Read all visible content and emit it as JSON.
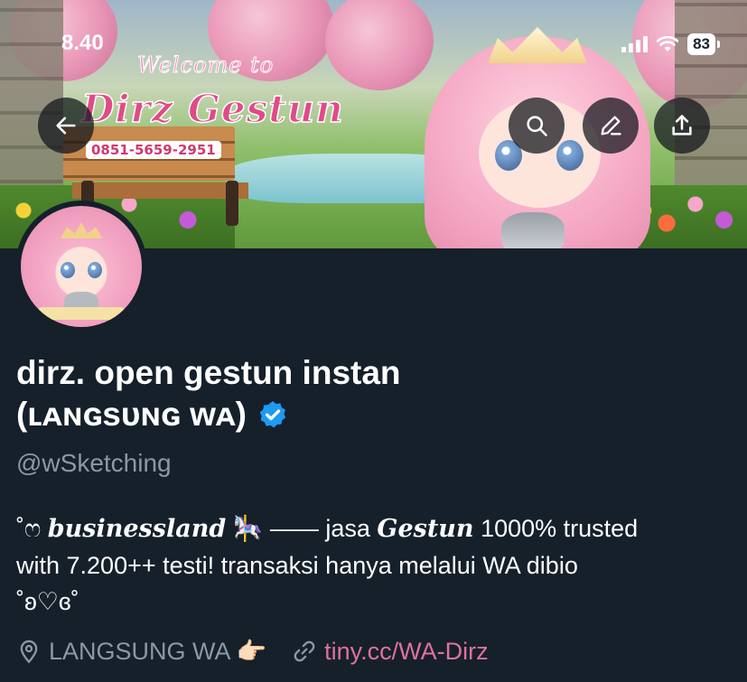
{
  "status_bar": {
    "time": "8.40",
    "battery": "83"
  },
  "banner": {
    "welcome_text": "Welcome to",
    "brand_text": "Dirz Gestun",
    "phone_text": "0851-5659-2951"
  },
  "toolbar": {
    "back_icon": "arrow-left-icon",
    "search_icon": "search-icon",
    "edit_icon": "pencil-icon",
    "share_icon": "share-icon"
  },
  "profile": {
    "display_name_line1": "dirz. open gestun instan",
    "display_name_line2": "(ʟᴀɴɢsᴜɴɢ ᴡᴀ)",
    "handle": "@wSketching",
    "bio": {
      "prefix": "˚ෆ ",
      "bold_word": "businessland",
      "emoji": " 🎠 ",
      "dash": "—— jasa ",
      "bold_word2": "Gestun",
      "rest_line1": " 1000% trusted",
      "line2": "with 7.200++ testi! transaksi hanya melalui WA dibio",
      "line3": "˚ʚ♡ɞ˚"
    },
    "location": "LANGSUNG WA 👉🏻",
    "link": "tiny.cc/WA-Dirz"
  },
  "colors": {
    "background": "#15202b",
    "secondary_text": "#8b98a5",
    "link": "#e0709d",
    "verified": "#1d9bf0"
  }
}
